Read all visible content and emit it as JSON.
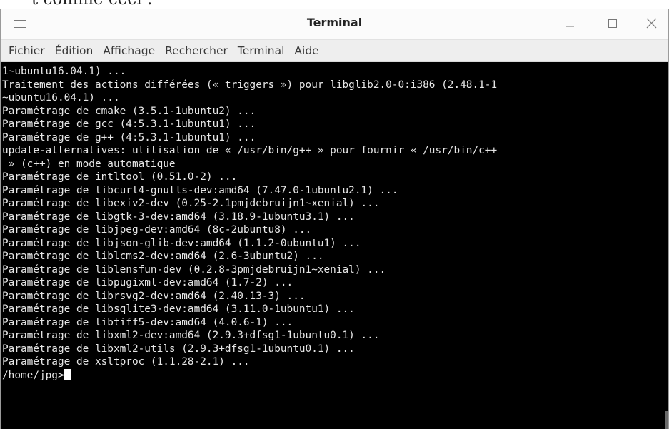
{
  "context_text": "t comme ceci :",
  "window": {
    "title": "Terminal",
    "menu_icon": "hamburger-menu-icon",
    "minimize_icon": "minimize-icon",
    "maximize_icon": "maximize-icon",
    "close_icon": "close-icon"
  },
  "menubar": {
    "items": [
      "Fichier",
      "Édition",
      "Affichage",
      "Rechercher",
      "Terminal",
      "Aide"
    ]
  },
  "terminal": {
    "lines": [
      "1~ubuntu16.04.1) ...",
      "Traitement des actions différées (« triggers ») pour libglib2.0-0:i386 (2.48.1-1",
      "~ubuntu16.04.1) ...",
      "Paramétrage de cmake (3.5.1-1ubuntu2) ...",
      "Paramétrage de gcc (4:5.3.1-1ubuntu1) ...",
      "Paramétrage de g++ (4:5.3.1-1ubuntu1) ...",
      "update-alternatives: utilisation de « /usr/bin/g++ » pour fournir « /usr/bin/c++",
      " » (c++) en mode automatique",
      "Paramétrage de intltool (0.51.0-2) ...",
      "Paramétrage de libcurl4-gnutls-dev:amd64 (7.47.0-1ubuntu2.1) ...",
      "Paramétrage de libexiv2-dev (0.25-2.1pmjdebruijn1~xenial) ...",
      "Paramétrage de libgtk-3-dev:amd64 (3.18.9-1ubuntu3.1) ...",
      "Paramétrage de libjpeg-dev:amd64 (8c-2ubuntu8) ...",
      "Paramétrage de libjson-glib-dev:amd64 (1.1.2-0ubuntu1) ...",
      "Paramétrage de liblcms2-dev:amd64 (2.6-3ubuntu2) ...",
      "Paramétrage de liblensfun-dev (0.2.8-3pmjdebruijn1~xenial) ...",
      "Paramétrage de libpugixml-dev:amd64 (1.7-2) ...",
      "Paramétrage de librsvg2-dev:amd64 (2.40.13-3) ...",
      "Paramétrage de libsqlite3-dev:amd64 (3.11.0-1ubuntu1) ...",
      "Paramétrage de libtiff5-dev:amd64 (4.0.6-1) ...",
      "Paramétrage de libxml2-dev:amd64 (2.9.3+dfsg1-1ubuntu0.1) ...",
      "Paramétrage de libxml2-utils (2.9.3+dfsg1-1ubuntu0.1) ...",
      "Paramétrage de xsltproc (1.1.28-2.1) ..."
    ],
    "prompt": "/home/jpg>"
  },
  "colors": {
    "terminal_bg": "#000000",
    "terminal_fg": "#e6e6e6",
    "titlebar_bg": "#fbfbfb",
    "menubar_bg": "#eeeeee"
  }
}
